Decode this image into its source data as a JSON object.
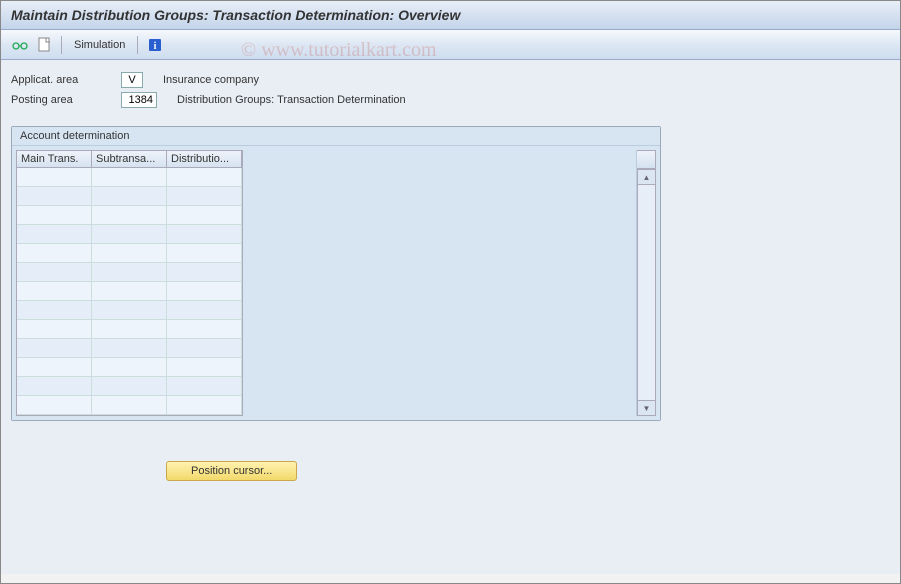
{
  "title": "Maintain Distribution Groups: Transaction Determination: Overview",
  "toolbar": {
    "simulation_label": "Simulation"
  },
  "fields": {
    "applicat_area": {
      "label": "Applicat. area",
      "value": "V",
      "desc": "Insurance company"
    },
    "posting_area": {
      "label": "Posting area",
      "value": "1384",
      "desc": "Distribution Groups: Transaction Determination"
    }
  },
  "panel": {
    "title": "Account determination",
    "columns": [
      "Main Trans.",
      "Subtransa...",
      "Distributio..."
    ],
    "row_count": 13
  },
  "buttons": {
    "position_cursor": "Position cursor..."
  },
  "watermark": "© www.tutorialkart.com"
}
